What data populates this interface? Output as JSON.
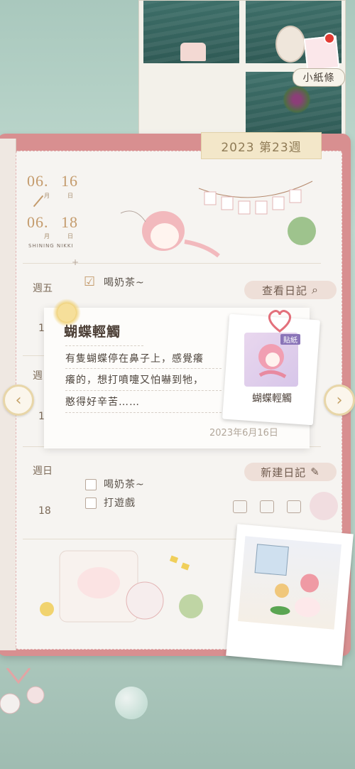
{
  "top": {
    "paper_note_label": "小紙條"
  },
  "week_tab": "2023 第23週",
  "date_range": {
    "start_month": "06.",
    "start_day": "16",
    "end_month": "06.",
    "end_day": "18",
    "month_char": "月",
    "day_char": "日",
    "brand": "SHINING NIKKI"
  },
  "rows": [
    {
      "day": "週五",
      "entries": [
        "喝奶茶~"
      ],
      "button": "查看日記"
    },
    {
      "day_partial": "1"
    },
    {
      "day_partial": "週"
    },
    {
      "day_partial": "1"
    },
    {
      "day": "週日",
      "date": "18",
      "entries": [
        "喝奶茶~",
        "打遊戲"
      ],
      "button": "新建日記"
    }
  ],
  "popup": {
    "title": "蝴蝶輕觸",
    "body_lines": [
      "有隻蝴蝶停在鼻子上，感覺癢",
      "癢的，想打噴嚏又怕嚇到牠，",
      "憨得好辛苦……"
    ],
    "date": "2023年6月16日",
    "sticker_tag": "貼紙",
    "sticker_label": "蝴蝶輕觸"
  },
  "colors": {
    "accent_gold": "#c49b6c",
    "notebook_pink": "#d88f90",
    "tab_cream": "#f3e7c9"
  }
}
